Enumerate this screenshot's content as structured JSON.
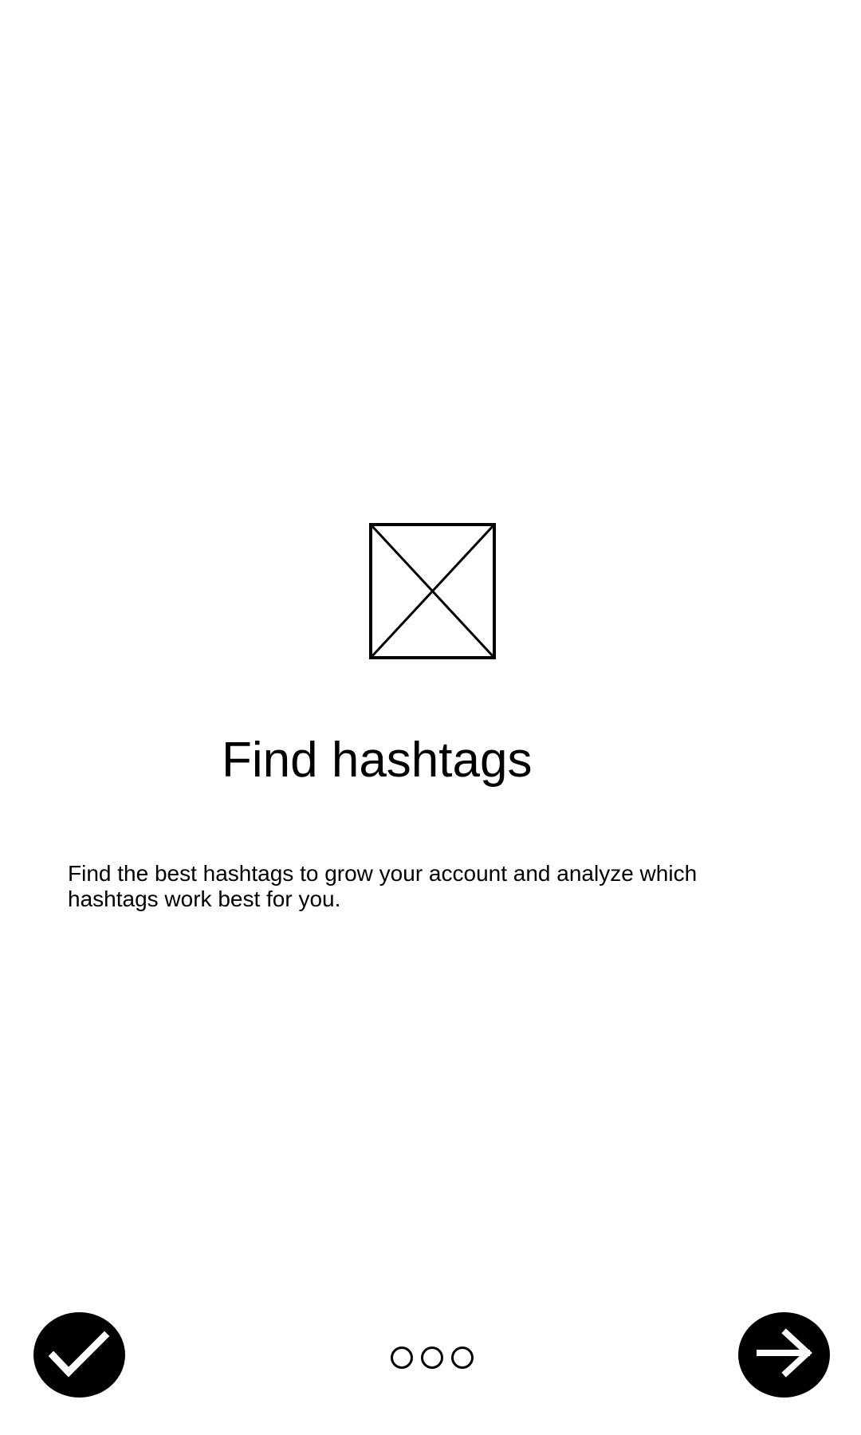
{
  "onboarding": {
    "illustration_icon": "image-placeholder-icon",
    "title": "Find hashtags",
    "description": "Find the best hashtags to grow your account and analyze which hashtags work best for you.",
    "page_indicator": {
      "total_pages": 3
    },
    "done_button_icon": "checkmark-icon",
    "next_button_icon": "arrow-right-icon"
  },
  "colors": {
    "background": "#ffffff",
    "foreground": "#000000"
  }
}
